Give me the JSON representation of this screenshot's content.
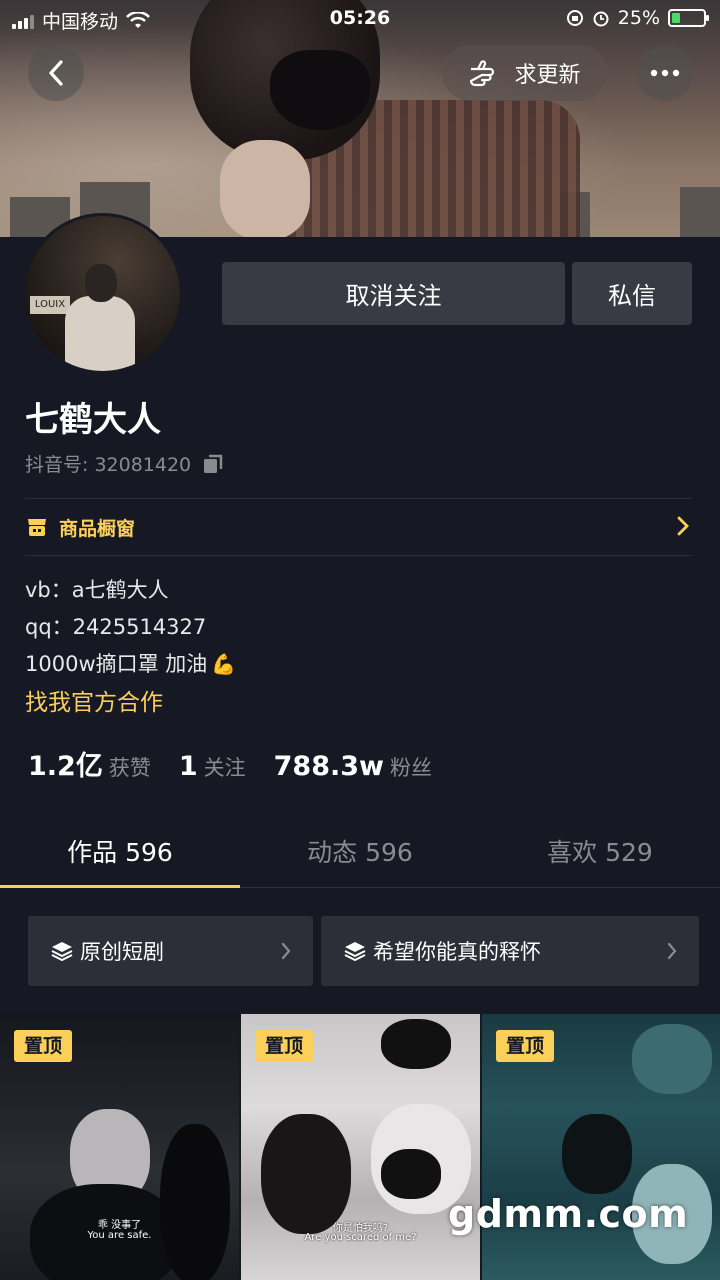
{
  "status_bar": {
    "carrier": "中国移动",
    "time": "05:26",
    "battery": "25%",
    "battery_level": 0.25
  },
  "header": {
    "update_label": "求更新"
  },
  "profile": {
    "unfollow_label": "取消关注",
    "message_label": "私信",
    "nickname": "七鹤大人",
    "douyin_id": "抖音号: 32081420",
    "shop_label": "商品橱窗",
    "bio": [
      "vb：a七鹤大人",
      "qq：2425514327",
      "1000w摘口罩 加油"
    ],
    "bio_emoji": "💪",
    "cooperation_link": "找我官方合作"
  },
  "stats": {
    "likes_num": "1.2亿",
    "likes_label": "获赞",
    "following_num": "1",
    "following_label": "关注",
    "followers_num": "788.3w",
    "followers_label": "粉丝"
  },
  "tabs": [
    {
      "label": "作品 596",
      "active": true
    },
    {
      "label": "动态 596",
      "active": false
    },
    {
      "label": "喜欢 529",
      "active": false
    }
  ],
  "collections": [
    {
      "label": "原创短剧"
    },
    {
      "label": "希望你能真的释怀"
    }
  ],
  "videos": [
    {
      "badge": "置顶",
      "subtitle_cn": "乖 没事了",
      "subtitle_en": "You are safe."
    },
    {
      "badge": "置顶",
      "subtitle_cn": "你是怕我吗?",
      "subtitle_en": "Are you scared of me?"
    },
    {
      "badge": "置顶"
    }
  ],
  "watermark": "gdmm.com",
  "colors": {
    "background": "#161823",
    "accent": "#facf5a",
    "button": "#393b44"
  }
}
